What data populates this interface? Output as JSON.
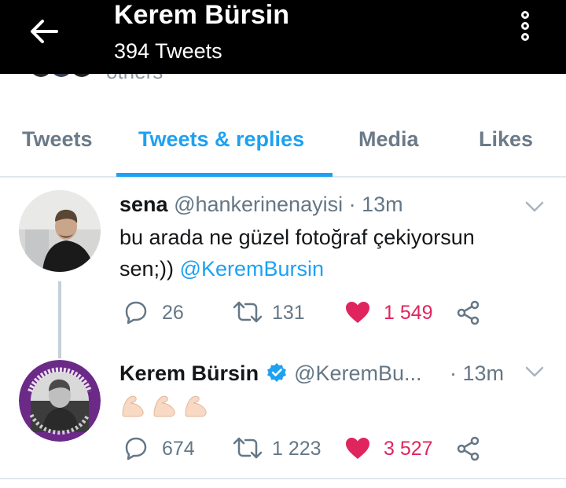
{
  "header": {
    "title": "Kerem Bürsin",
    "subtitle": "394 Tweets"
  },
  "peek": {
    "others_text": "others"
  },
  "tabs": [
    {
      "label": "Tweets"
    },
    {
      "label": "Tweets & replies"
    },
    {
      "label": "Media"
    },
    {
      "label": "Likes"
    }
  ],
  "tweets": [
    {
      "name": "sena",
      "handle": "@hankerinenayisi",
      "separator": "·",
      "time": "13m",
      "text_line1": "bu arada ne güzel fotoğraf çekiyorsun",
      "text_line2_plain": "sen;)) ",
      "text_line2_mention": "@KeremBursin",
      "replies": "26",
      "retweets": "131",
      "likes": "1 549"
    },
    {
      "name": "Kerem Bürsin",
      "handle": "@KeremBu...",
      "separator": "·",
      "time": "13m",
      "body_emoji": "💪💪💪",
      "avatar_ring_text_top": "İSTANBUL SÖZLEŞMESİ YAŞATIR",
      "avatar_ring_text_bottom": "TCK 103   6284 UYGULA",
      "replies": "674",
      "retweets": "1 223",
      "likes": "3 527"
    }
  ],
  "colors": {
    "accent": "#1da1f2",
    "like": "#e0245e",
    "muted": "#657786",
    "avatar_ring": "#6b2a88"
  }
}
